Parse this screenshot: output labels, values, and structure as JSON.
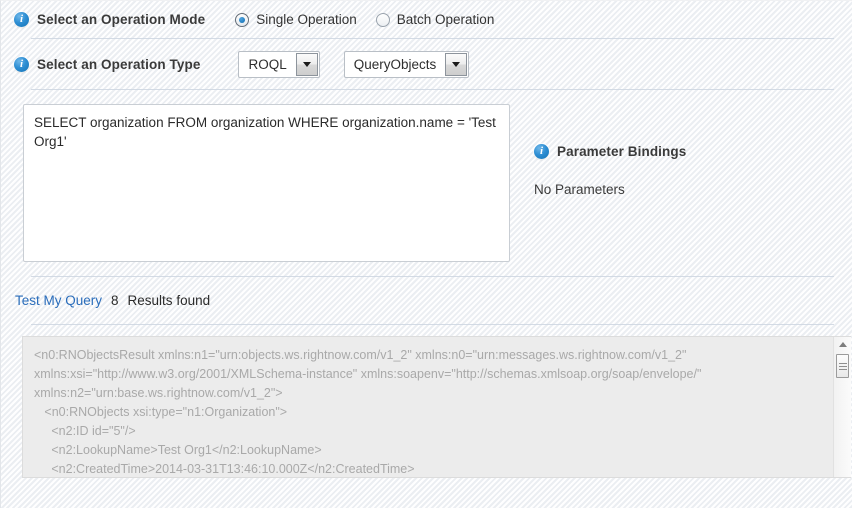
{
  "operation_mode": {
    "label": "Select an Operation Mode",
    "info_icon": "info-icon",
    "options": [
      {
        "label": "Single Operation",
        "selected": true
      },
      {
        "label": "Batch Operation",
        "selected": false
      }
    ]
  },
  "operation_type": {
    "label": "Select an Operation Type",
    "info_icon": "info-icon",
    "language_select": {
      "value": "ROQL",
      "arrow_icon": "chevron-down-icon"
    },
    "operation_select": {
      "value": "QueryObjects",
      "arrow_icon": "chevron-down-icon"
    }
  },
  "query": {
    "text": "SELECT organization FROM organization WHERE organization.name = 'Test Org1'"
  },
  "parameter_bindings": {
    "title": "Parameter Bindings",
    "info_icon": "info-icon",
    "empty_text": "No Parameters"
  },
  "test_query": {
    "link_label": "Test My Query",
    "count": "8",
    "count_label": "Results found"
  },
  "result_panel": {
    "xml": "<n0:RNObjectsResult xmlns:n1=\"urn:objects.ws.rightnow.com/v1_2\" xmlns:n0=\"urn:messages.ws.rightnow.com/v1_2\"\nxmlns:xsi=\"http://www.w3.org/2001/XMLSchema-instance\" xmlns:soapenv=\"http://schemas.xmlsoap.org/soap/envelope/\"\nxmlns:n2=\"urn:base.ws.rightnow.com/v1_2\">\n   <n0:RNObjects xsi:type=\"n1:Organization\">\n     <n2:ID id=\"5\"/>\n     <n2:LookupName>Test Org1</n2:LookupName>\n     <n2:CreatedTime>2014-03-31T13:46:10.000Z</n2:CreatedTime>",
    "scrollbar": {
      "up_arrow_icon": "caret-up-icon",
      "thumb_icon": "scrollbar-thumb-grip"
    }
  },
  "colors": {
    "link": "#2a6dbb",
    "info_blue": "#1272b5",
    "panel_bg": "#ececec",
    "xml_text": "#a9a9a9",
    "divider": "#ccd5e0"
  }
}
